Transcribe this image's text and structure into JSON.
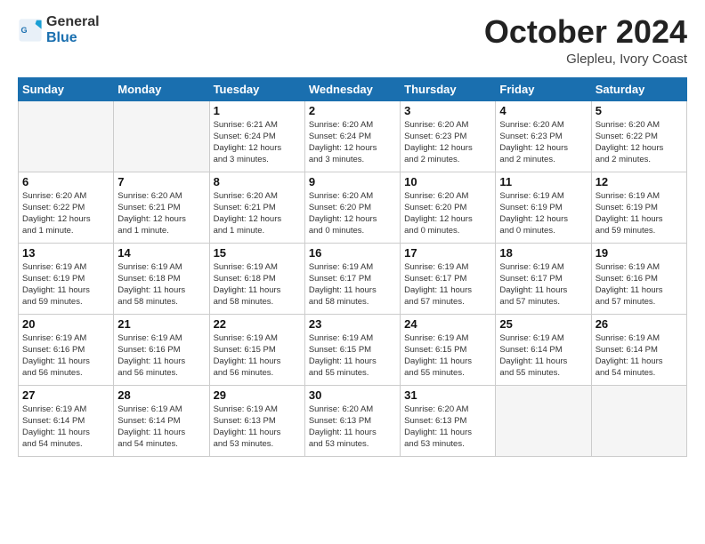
{
  "header": {
    "logo_general": "General",
    "logo_blue": "Blue",
    "month": "October 2024",
    "location": "Glepleu, Ivory Coast"
  },
  "weekdays": [
    "Sunday",
    "Monday",
    "Tuesday",
    "Wednesday",
    "Thursday",
    "Friday",
    "Saturday"
  ],
  "weeks": [
    [
      {
        "day": "",
        "info": ""
      },
      {
        "day": "",
        "info": ""
      },
      {
        "day": "1",
        "info": "Sunrise: 6:21 AM\nSunset: 6:24 PM\nDaylight: 12 hours\nand 3 minutes."
      },
      {
        "day": "2",
        "info": "Sunrise: 6:20 AM\nSunset: 6:24 PM\nDaylight: 12 hours\nand 3 minutes."
      },
      {
        "day": "3",
        "info": "Sunrise: 6:20 AM\nSunset: 6:23 PM\nDaylight: 12 hours\nand 2 minutes."
      },
      {
        "day": "4",
        "info": "Sunrise: 6:20 AM\nSunset: 6:23 PM\nDaylight: 12 hours\nand 2 minutes."
      },
      {
        "day": "5",
        "info": "Sunrise: 6:20 AM\nSunset: 6:22 PM\nDaylight: 12 hours\nand 2 minutes."
      }
    ],
    [
      {
        "day": "6",
        "info": "Sunrise: 6:20 AM\nSunset: 6:22 PM\nDaylight: 12 hours\nand 1 minute."
      },
      {
        "day": "7",
        "info": "Sunrise: 6:20 AM\nSunset: 6:21 PM\nDaylight: 12 hours\nand 1 minute."
      },
      {
        "day": "8",
        "info": "Sunrise: 6:20 AM\nSunset: 6:21 PM\nDaylight: 12 hours\nand 1 minute."
      },
      {
        "day": "9",
        "info": "Sunrise: 6:20 AM\nSunset: 6:20 PM\nDaylight: 12 hours\nand 0 minutes."
      },
      {
        "day": "10",
        "info": "Sunrise: 6:20 AM\nSunset: 6:20 PM\nDaylight: 12 hours\nand 0 minutes."
      },
      {
        "day": "11",
        "info": "Sunrise: 6:19 AM\nSunset: 6:19 PM\nDaylight: 12 hours\nand 0 minutes."
      },
      {
        "day": "12",
        "info": "Sunrise: 6:19 AM\nSunset: 6:19 PM\nDaylight: 11 hours\nand 59 minutes."
      }
    ],
    [
      {
        "day": "13",
        "info": "Sunrise: 6:19 AM\nSunset: 6:19 PM\nDaylight: 11 hours\nand 59 minutes."
      },
      {
        "day": "14",
        "info": "Sunrise: 6:19 AM\nSunset: 6:18 PM\nDaylight: 11 hours\nand 58 minutes."
      },
      {
        "day": "15",
        "info": "Sunrise: 6:19 AM\nSunset: 6:18 PM\nDaylight: 11 hours\nand 58 minutes."
      },
      {
        "day": "16",
        "info": "Sunrise: 6:19 AM\nSunset: 6:17 PM\nDaylight: 11 hours\nand 58 minutes."
      },
      {
        "day": "17",
        "info": "Sunrise: 6:19 AM\nSunset: 6:17 PM\nDaylight: 11 hours\nand 57 minutes."
      },
      {
        "day": "18",
        "info": "Sunrise: 6:19 AM\nSunset: 6:17 PM\nDaylight: 11 hours\nand 57 minutes."
      },
      {
        "day": "19",
        "info": "Sunrise: 6:19 AM\nSunset: 6:16 PM\nDaylight: 11 hours\nand 57 minutes."
      }
    ],
    [
      {
        "day": "20",
        "info": "Sunrise: 6:19 AM\nSunset: 6:16 PM\nDaylight: 11 hours\nand 56 minutes."
      },
      {
        "day": "21",
        "info": "Sunrise: 6:19 AM\nSunset: 6:16 PM\nDaylight: 11 hours\nand 56 minutes."
      },
      {
        "day": "22",
        "info": "Sunrise: 6:19 AM\nSunset: 6:15 PM\nDaylight: 11 hours\nand 56 minutes."
      },
      {
        "day": "23",
        "info": "Sunrise: 6:19 AM\nSunset: 6:15 PM\nDaylight: 11 hours\nand 55 minutes."
      },
      {
        "day": "24",
        "info": "Sunrise: 6:19 AM\nSunset: 6:15 PM\nDaylight: 11 hours\nand 55 minutes."
      },
      {
        "day": "25",
        "info": "Sunrise: 6:19 AM\nSunset: 6:14 PM\nDaylight: 11 hours\nand 55 minutes."
      },
      {
        "day": "26",
        "info": "Sunrise: 6:19 AM\nSunset: 6:14 PM\nDaylight: 11 hours\nand 54 minutes."
      }
    ],
    [
      {
        "day": "27",
        "info": "Sunrise: 6:19 AM\nSunset: 6:14 PM\nDaylight: 11 hours\nand 54 minutes."
      },
      {
        "day": "28",
        "info": "Sunrise: 6:19 AM\nSunset: 6:14 PM\nDaylight: 11 hours\nand 54 minutes."
      },
      {
        "day": "29",
        "info": "Sunrise: 6:19 AM\nSunset: 6:13 PM\nDaylight: 11 hours\nand 53 minutes."
      },
      {
        "day": "30",
        "info": "Sunrise: 6:20 AM\nSunset: 6:13 PM\nDaylight: 11 hours\nand 53 minutes."
      },
      {
        "day": "31",
        "info": "Sunrise: 6:20 AM\nSunset: 6:13 PM\nDaylight: 11 hours\nand 53 minutes."
      },
      {
        "day": "",
        "info": ""
      },
      {
        "day": "",
        "info": ""
      }
    ]
  ]
}
